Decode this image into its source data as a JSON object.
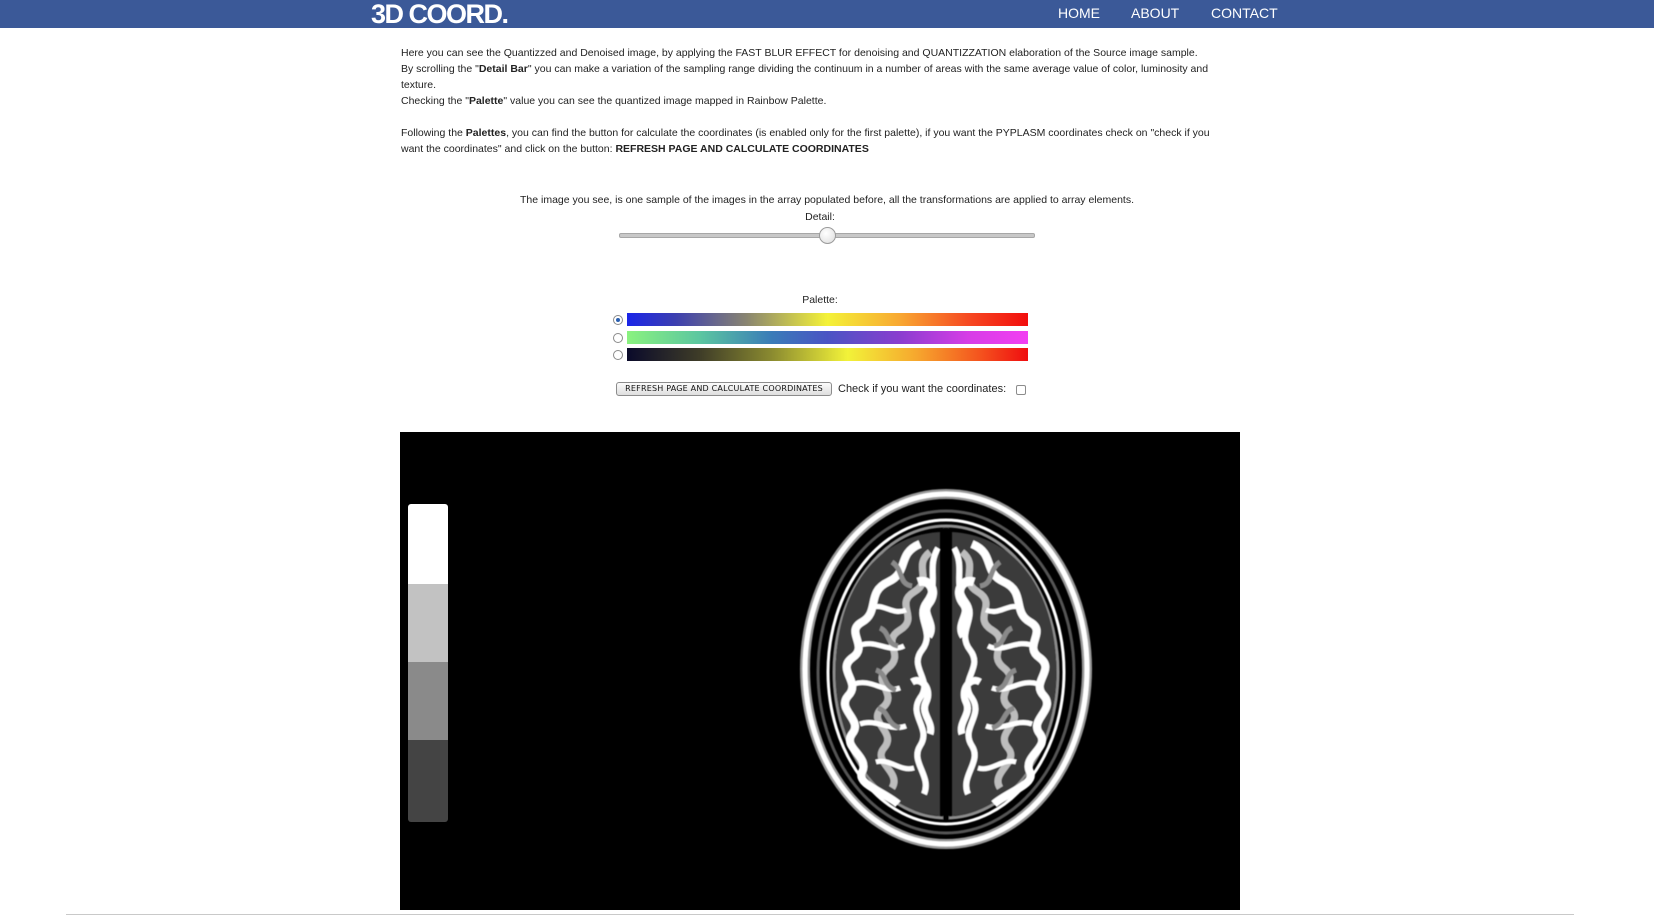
{
  "site": {
    "logo": "3D COORD."
  },
  "nav": {
    "home": "HOME",
    "about": "ABOUT",
    "contact": "CONTACT"
  },
  "intro": {
    "p1": "Here you can see the Quantizzed and Denoised image, by applying the FAST BLUR EFFECT for denoising and QUANTIZZATION elaboration of the Source image sample.",
    "p2_pre": "By scrolling the \"",
    "p2_bold": "Detail Bar",
    "p2_post": "\" you can make a variation of the sampling range dividing the continuum in a number of areas with the same average value of color, luminosity and texture.",
    "p3_pre": "Checking the \"",
    "p3_bold": "Palette",
    "p3_post": "\" value you can see the quantized image mapped in Rainbow Palette.",
    "p4_pre": "Following the ",
    "p4_bold": "Palettes",
    "p4_mid": ", you can find the button for calculate the coordinates (is enabled only for the first palette), if you want the PYPLASM coordinates check on \"check if you want the coordinates\" and click on the button: ",
    "p4_bold2": "REFRESH PAGE AND CALCULATE COORDINATES"
  },
  "sample_note": "The image you see, is one sample of the images in the array populated before, all the transformations are applied to array elements.",
  "detail": {
    "label": "Detail:",
    "level": 0.5
  },
  "palette": {
    "label": "Palette:",
    "selected_index": 0,
    "options": [
      {
        "colors": [
          "#1a25e8",
          "#f4f238",
          "#f20d0d"
        ]
      },
      {
        "colors": [
          "#8af27f",
          "#4a54c4",
          "#f23ff2"
        ]
      },
      {
        "colors": [
          "#0a0a2a",
          "#f2f239",
          "#f00d10"
        ]
      }
    ]
  },
  "actions": {
    "refresh_label": "REFRESH PAGE AND CALCULATE COORDINATES",
    "coords_label": "Check if you want the coordinates:",
    "coords_checked": false
  },
  "viewer": {
    "background": "#000000",
    "legend_levels": [
      "#ffffff",
      "#c2c2c2",
      "#8a8a8a",
      "#444444"
    ]
  },
  "colors": {
    "navbar": "#3b5998",
    "nav_text": "#ffffff"
  }
}
